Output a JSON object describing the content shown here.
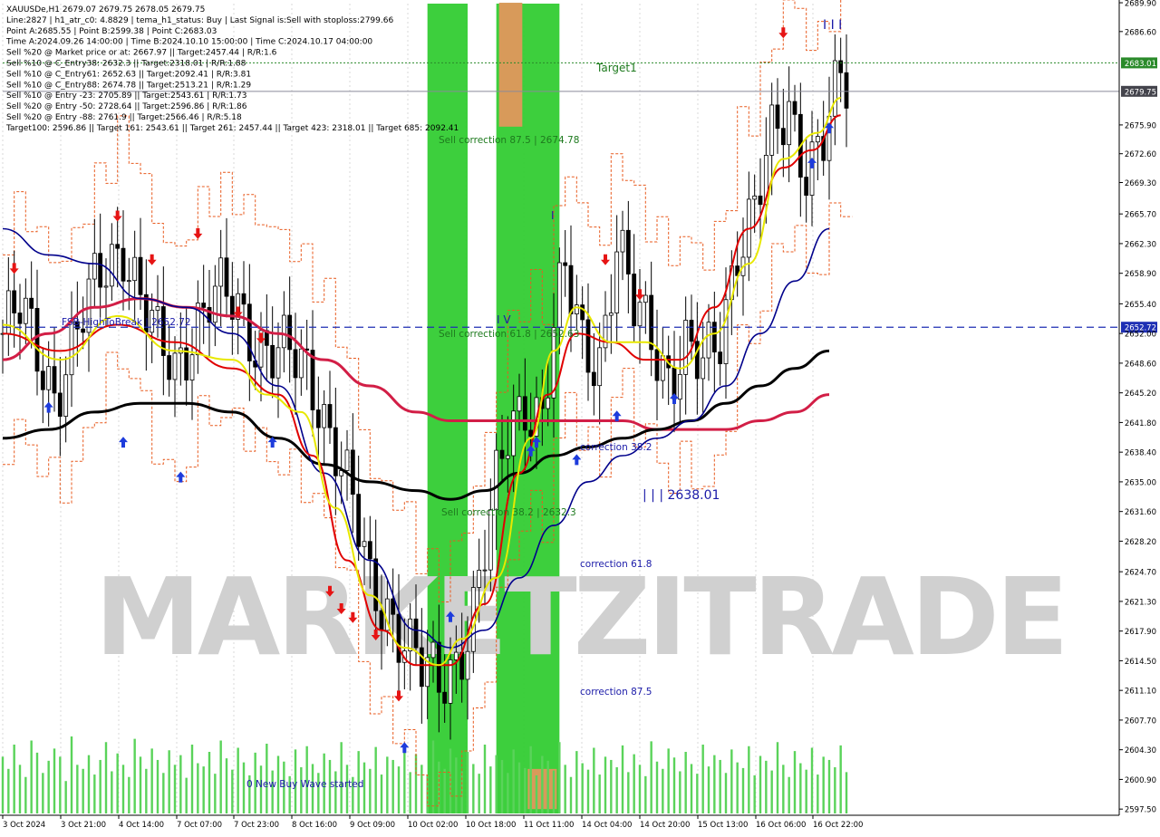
{
  "colors": {
    "background": "#ffffff",
    "grid": "#d8d8d8",
    "candle": "#000000",
    "volume": "#5ad35a",
    "green_band": "#33cc33",
    "orange_box": "#d89a5a",
    "ema_fast": "#e8e800",
    "ema_mid": "#e00000",
    "ema_blue": "#00008b",
    "ema_black": "#000000",
    "ema_crimson": "#d21e46",
    "envelope": "#e85a1e",
    "buy_arrow": "#1e3cdc",
    "sell_arrow": "#e61414",
    "target_line": "#2a8a2a",
    "level_line": "#1e2fb4",
    "blue_text": "#1a1aa8",
    "green_text": "#1e7a1e",
    "watermark": "#d0d0d0"
  },
  "header_lines": [
    "XAUUSDe,H1  2679.07 2679.75 2678.05 2679.75",
    "Line:2827 | h1_atr_c0: 4.8829 | tema_h1_status: Buy | Last Signal is:Sell with stoploss:2799.66",
    "Point A:2685.55 | Point B:2599.38 | Point C:2683.03",
    "Time A:2024.09.26 14:00:00 | Time B:2024.10.10 15:00:00 | Time C:2024.10.17 04:00:00",
    "Sell %20 @ Market price or at: 2667.97 || Target:2457.44 | R/R:1.6",
    "Sell %10 @ C_Entry38: 2632.3 || Target:2318.01 | R/R:1.88",
    "Sell %10 @ C_Entry61: 2652.63 || Target:2092.41 | R/R:3.81",
    "Sell %10 @ C_Entry88: 2674.78 || Target:2513.21 | R/R:1.29",
    "Sell %10 @ Entry -23: 2705.89 || Target:2543.61 | R/R:1.73",
    "Sell %20 @ Entry -50: 2728.64 || Target:2596.86 | R/R:1.86",
    "Sell %20 @ Entry -88: 2761.9 || Target:2566.46 | R/R:5.18",
    "Target100: 2596.86 || Target 161: 2543.61 || Target 261: 2457.44 || Target 423: 2318.01 || Target 685: 2092.41"
  ],
  "annotations": {
    "target1": "Target1",
    "sell_corr_875": "Sell correction 87.5 | 2674.78",
    "sell_corr_618": "Sell correction 61.8 | 2652.63",
    "sell_corr_382": "Sell correction 38.2 | 2632.3",
    "fsb": "FSB-HighToBreak | 2652.72",
    "corr_382": "correction 38.2",
    "corr_618": "correction 61.8",
    "corr_875": "correction 87.5",
    "low_level": "| | | 2638.01",
    "buy_wave": "0 New Buy Wave started",
    "mark_iv": "I V",
    "mark_i": "I",
    "mark_iii": "I I I",
    "watermark": "MARKETZITRADE"
  },
  "chart_data": {
    "type": "candlestick",
    "symbol": "XAUUSDe",
    "timeframe": "H1",
    "ylim": [
      2597.0,
      2689.8
    ],
    "y_ticks": [
      "2689.90",
      "2686.60",
      "2683.01",
      "2679.75",
      "2675.90",
      "2672.60",
      "2669.30",
      "2665.70",
      "2662.30",
      "2658.90",
      "2655.40",
      "2652.72",
      "2652.00",
      "2648.60",
      "2645.20",
      "2641.80",
      "2638.40",
      "2635.00",
      "2631.60",
      "2628.20",
      "2624.70",
      "2621.30",
      "2617.90",
      "2614.50",
      "2611.10",
      "2607.70",
      "2604.30",
      "2600.90",
      "2597.50"
    ],
    "y_tick_values": [
      2689.9,
      2686.6,
      2683.01,
      2679.75,
      2675.9,
      2672.6,
      2669.3,
      2665.7,
      2662.3,
      2658.9,
      2655.4,
      2652.72,
      2652.0,
      2648.6,
      2645.2,
      2641.8,
      2638.4,
      2635.0,
      2631.6,
      2628.2,
      2624.7,
      2621.3,
      2617.9,
      2614.5,
      2611.1,
      2607.7,
      2604.3,
      2600.9,
      2597.5
    ],
    "highlight_prices": {
      "target": 2683.01,
      "current": 2679.75,
      "fsb": 2652.72
    },
    "x_ticks": [
      "3 Oct 2024",
      "3 Oct 21:00",
      "4 Oct 14:00",
      "7 Oct 07:00",
      "7 Oct 23:00",
      "8 Oct 16:00",
      "9 Oct 09:00",
      "10 Oct 02:00",
      "10 Oct 18:00",
      "11 Oct 11:00",
      "14 Oct 04:00",
      "14 Oct 20:00",
      "15 Oct 13:00",
      "16 Oct 06:00",
      "16 Oct 22:00"
    ],
    "bar_count": 148,
    "close_path": [
      [
        0,
        2652
      ],
      [
        3,
        2654
      ],
      [
        6,
        2650
      ],
      [
        9,
        2646
      ],
      [
        12,
        2650
      ],
      [
        15,
        2655
      ],
      [
        18,
        2660
      ],
      [
        21,
        2663
      ],
      [
        24,
        2656
      ],
      [
        27,
        2650
      ],
      [
        30,
        2648
      ],
      [
        33,
        2653
      ],
      [
        36,
        2656
      ],
      [
        40,
        2655
      ],
      [
        44,
        2652
      ],
      [
        48,
        2650
      ],
      [
        51,
        2648
      ],
      [
        53,
        2647
      ],
      [
        55,
        2645
      ],
      [
        58,
        2640
      ],
      [
        61,
        2632
      ],
      [
        64,
        2622
      ],
      [
        67,
        2621
      ],
      [
        70,
        2618
      ],
      [
        73,
        2613
      ],
      [
        76,
        2611
      ],
      [
        79,
        2615
      ],
      [
        82,
        2621
      ],
      [
        85,
        2630
      ],
      [
        88,
        2640
      ],
      [
        91,
        2645
      ],
      [
        94,
        2643
      ],
      [
        96,
        2652
      ],
      [
        98,
        2658
      ],
      [
        101,
        2651
      ],
      [
        104,
        2650
      ],
      [
        107,
        2662
      ],
      [
        110,
        2654
      ],
      [
        113,
        2652
      ],
      [
        116,
        2648
      ],
      [
        119,
        2650
      ],
      [
        122,
        2647
      ],
      [
        125,
        2652
      ],
      [
        128,
        2663
      ],
      [
        131,
        2666
      ],
      [
        134,
        2673
      ],
      [
        137,
        2678
      ],
      [
        140,
        2672
      ],
      [
        143,
        2674
      ],
      [
        146,
        2680
      ],
      [
        147,
        2679.75
      ]
    ],
    "volumes": [
      70,
      55,
      85,
      60,
      45,
      90,
      75,
      50,
      65,
      80,
      70,
      40,
      95,
      60,
      55,
      72,
      48,
      66,
      88,
      52,
      74,
      60,
      45,
      92,
      70,
      55,
      80,
      66,
      50,
      78,
      60,
      72,
      44,
      85,
      62,
      58,
      76,
      49,
      90,
      68,
      54,
      81,
      63,
      47,
      75,
      59,
      86,
      53,
      71,
      64,
      46,
      79,
      57,
      83,
      61,
      50,
      74,
      66,
      52,
      88,
      60,
      45,
      77,
      63,
      55,
      82,
      48,
      70,
      66,
      58,
      84,
      51,
      73,
      60,
      47,
      90,
      64,
      55,
      80,
      69,
      52,
      76,
      61,
      49,
      85,
      58,
      72,
      66,
      50,
      79,
      63,
      56,
      83,
      47,
      71,
      65,
      53,
      88,
      60,
      45,
      77,
      62,
      54,
      81,
      48,
      70,
      66,
      57,
      84,
      51,
      73,
      60,
      46,
      89,
      64,
      55,
      80,
      69,
      52,
      76,
      61,
      49,
      85,
      58,
      72,
      66,
      50,
      79,
      63,
      56,
      83,
      47,
      71,
      65,
      53,
      88,
      60,
      45,
      77,
      62,
      54,
      81,
      48,
      70,
      66,
      57,
      84,
      51
    ],
    "ema_fast": [
      [
        0,
        2653
      ],
      [
        10,
        2649
      ],
      [
        20,
        2654
      ],
      [
        30,
        2650
      ],
      [
        40,
        2649
      ],
      [
        46,
        2645
      ],
      [
        52,
        2643
      ],
      [
        58,
        2632
      ],
      [
        64,
        2622
      ],
      [
        70,
        2616
      ],
      [
        76,
        2614
      ],
      [
        80,
        2617
      ],
      [
        86,
        2624
      ],
      [
        92,
        2640
      ],
      [
        96,
        2650
      ],
      [
        100,
        2655
      ],
      [
        106,
        2651
      ],
      [
        112,
        2651
      ],
      [
        118,
        2648
      ],
      [
        124,
        2652
      ],
      [
        130,
        2660
      ],
      [
        136,
        2672
      ],
      [
        142,
        2675
      ],
      [
        146,
        2679
      ]
    ],
    "ema_mid": [
      [
        0,
        2652
      ],
      [
        10,
        2650
      ],
      [
        20,
        2653
      ],
      [
        30,
        2651
      ],
      [
        40,
        2648
      ],
      [
        48,
        2645
      ],
      [
        54,
        2638
      ],
      [
        60,
        2626
      ],
      [
        66,
        2618
      ],
      [
        72,
        2614
      ],
      [
        78,
        2614
      ],
      [
        84,
        2621
      ],
      [
        90,
        2636
      ],
      [
        95,
        2645
      ],
      [
        100,
        2652
      ],
      [
        106,
        2651
      ],
      [
        112,
        2649
      ],
      [
        118,
        2649
      ],
      [
        124,
        2655
      ],
      [
        130,
        2664
      ],
      [
        136,
        2671
      ],
      [
        141,
        2673
      ],
      [
        146,
        2677
      ]
    ],
    "ema_blue": [
      [
        0,
        2664
      ],
      [
        8,
        2661
      ],
      [
        16,
        2660
      ],
      [
        24,
        2656
      ],
      [
        32,
        2655
      ],
      [
        40,
        2652
      ],
      [
        48,
        2646
      ],
      [
        56,
        2636
      ],
      [
        64,
        2626
      ],
      [
        72,
        2618
      ],
      [
        78,
        2616
      ],
      [
        84,
        2618
      ],
      [
        90,
        2624
      ],
      [
        96,
        2630
      ],
      [
        102,
        2635
      ],
      [
        108,
        2638
      ],
      [
        114,
        2640
      ],
      [
        120,
        2642
      ],
      [
        126,
        2646
      ],
      [
        132,
        2652
      ],
      [
        138,
        2658
      ],
      [
        144,
        2664
      ]
    ],
    "ema_black": [
      [
        0,
        2640
      ],
      [
        8,
        2641
      ],
      [
        16,
        2643
      ],
      [
        24,
        2644
      ],
      [
        32,
        2644
      ],
      [
        40,
        2643
      ],
      [
        48,
        2640
      ],
      [
        56,
        2637
      ],
      [
        64,
        2635
      ],
      [
        72,
        2634
      ],
      [
        78,
        2633
      ],
      [
        84,
        2634
      ],
      [
        90,
        2636
      ],
      [
        96,
        2638
      ],
      [
        102,
        2639
      ],
      [
        108,
        2640
      ],
      [
        114,
        2641
      ],
      [
        120,
        2642
      ],
      [
        126,
        2644
      ],
      [
        132,
        2646
      ],
      [
        138,
        2648
      ],
      [
        144,
        2650
      ]
    ],
    "ema_crimson": [
      [
        0,
        2649
      ],
      [
        8,
        2652
      ],
      [
        16,
        2655
      ],
      [
        24,
        2656
      ],
      [
        32,
        2655
      ],
      [
        40,
        2654
      ],
      [
        48,
        2652
      ],
      [
        56,
        2649
      ],
      [
        64,
        2646
      ],
      [
        72,
        2643
      ],
      [
        78,
        2642
      ],
      [
        84,
        2642
      ],
      [
        90,
        2642
      ],
      [
        96,
        2642
      ],
      [
        102,
        2642
      ],
      [
        108,
        2642
      ],
      [
        114,
        2641
      ],
      [
        120,
        2641
      ],
      [
        126,
        2641
      ],
      [
        132,
        2642
      ],
      [
        138,
        2643
      ],
      [
        144,
        2645
      ]
    ],
    "green_bands": [
      [
        74,
        81
      ],
      [
        86,
        97
      ]
    ],
    "orange_boxes": [
      [
        2689.9,
        2675.7,
        86,
        91
      ],
      [
        2602.1,
        2597.5,
        91,
        97
      ]
    ],
    "buy_arrows": [
      [
        8,
        2645
      ],
      [
        21,
        2641
      ],
      [
        31,
        2637
      ],
      [
        47,
        2641
      ],
      [
        70,
        2606
      ],
      [
        78,
        2621
      ],
      [
        92,
        2640
      ],
      [
        93,
        2641
      ],
      [
        100,
        2639
      ],
      [
        107,
        2644
      ],
      [
        117,
        2646
      ],
      [
        141,
        2673
      ],
      [
        144,
        2677
      ]
    ],
    "sell_arrows": [
      [
        2,
        2658
      ],
      [
        20,
        2664
      ],
      [
        26,
        2659
      ],
      [
        34,
        2662
      ],
      [
        41,
        2653
      ],
      [
        45,
        2650
      ],
      [
        57,
        2621
      ],
      [
        59,
        2619
      ],
      [
        61,
        2618
      ],
      [
        65,
        2616
      ],
      [
        69,
        2609
      ],
      [
        105,
        2659
      ],
      [
        111,
        2655
      ],
      [
        136,
        2685
      ]
    ]
  }
}
